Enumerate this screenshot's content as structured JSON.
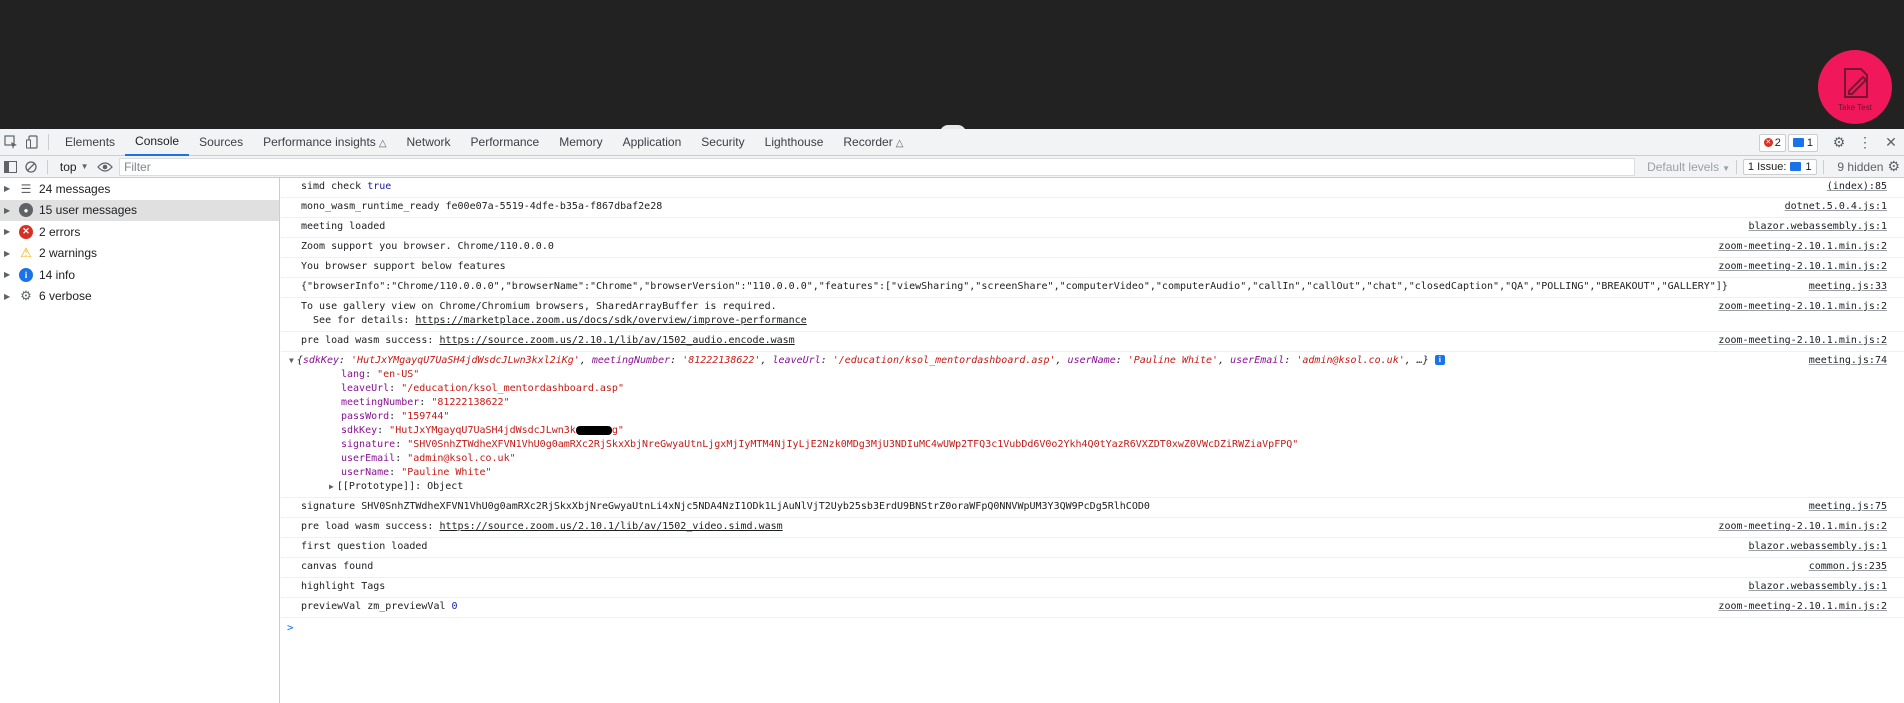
{
  "page": {
    "take_test_label": "Take Test"
  },
  "devtools": {
    "tabs": [
      {
        "label": "Elements"
      },
      {
        "label": "Console"
      },
      {
        "label": "Sources"
      },
      {
        "label": "Performance insights"
      },
      {
        "label": "Network"
      },
      {
        "label": "Performance"
      },
      {
        "label": "Memory"
      },
      {
        "label": "Application"
      },
      {
        "label": "Security"
      },
      {
        "label": "Lighthouse"
      },
      {
        "label": "Recorder"
      }
    ],
    "active_tab": "Console",
    "error_count": "2",
    "message_count": "1"
  },
  "toolbar": {
    "context": "top",
    "filter_placeholder": "Filter",
    "levels_label": "Default levels",
    "issues_label": "1 Issue:",
    "issues_count": "1",
    "hidden_label": "9 hidden"
  },
  "sidebar": {
    "items": [
      {
        "label": "24 messages",
        "icon": "list-icon"
      },
      {
        "label": "15 user messages",
        "icon": "user-icon"
      },
      {
        "label": "2 errors",
        "icon": "error-icon"
      },
      {
        "label": "2 warnings",
        "icon": "warning-icon"
      },
      {
        "label": "14 info",
        "icon": "info-icon"
      },
      {
        "label": "6 verbose",
        "icon": "verbose-icon"
      }
    ],
    "selected_index": 1
  },
  "console": {
    "messages": [
      {
        "text": "simd check ",
        "value": "true",
        "source": "(index):85"
      },
      {
        "text": "mono_wasm_runtime_ready fe00e07a-5519-4dfe-b35a-f867dbaf2e28",
        "source": "dotnet.5.0.4.js:1"
      },
      {
        "text": "meeting loaded",
        "source": "blazor.webassembly.js:1"
      },
      {
        "text": "Zoom support you browser. Chrome/110.0.0.0",
        "source": "zoom-meeting-2.10.1.min.js:2"
      },
      {
        "text": "You browser support below features",
        "source": "zoom-meeting-2.10.1.min.js:2"
      },
      {
        "text": "{\"browserInfo\":\"Chrome/110.0.0.0\",\"browserName\":\"Chrome\",\"browserVersion\":\"110.0.0.0\",\"features\":[\"viewSharing\",\"screenShare\",\"computerVideo\",\"computerAudio\",\"callIn\",\"callOut\",\"chat\",\"closedCaption\",\"QA\",\"POLLING\",\"BREAKOUT\",\"GALLERY\"]}",
        "source": "meeting.js:33"
      },
      {
        "text": "To use gallery view on Chrome/Chromium browsers, SharedArrayBuffer is required.",
        "text2": "  See for details: ",
        "link": "https://marketplace.zoom.us/docs/sdk/overview/improve-performance",
        "source": "zoom-meeting-2.10.1.min.js:2"
      },
      {
        "text": "pre load wasm success: ",
        "link": "https://source.zoom.us/2.10.1/lib/av/1502_audio.encode.wasm",
        "source": "zoom-meeting-2.10.1.min.js:2"
      }
    ],
    "object_entry": {
      "preview": {
        "sdkKey": "'HutJxYMgayqU7UaSH4jdWsdcJLwn3kxl2iKg'",
        "meetingNumber": "'81222138622'",
        "leaveUrl": "'/education/ksol_mentordashboard.asp'",
        "userName": "'Pauline White'",
        "userEmail": "'admin@ksol.co.uk'"
      },
      "source": "meeting.js:74",
      "props": [
        {
          "key": "lang",
          "value": "\"en-US\""
        },
        {
          "key": "leaveUrl",
          "value": "\"/education/ksol_mentordashboard.asp\""
        },
        {
          "key": "meetingNumber",
          "value": "\"81222138622\""
        },
        {
          "key": "passWord",
          "value": "\"159744\""
        },
        {
          "key": "sdkKey",
          "value": "\"HutJxYMgayqU7UaSH4jdWsdcJLwn3k",
          "value_tail": "g\""
        },
        {
          "key": "signature",
          "value": "\"SHV0SnhZTWdheXFVN1VhU0g0amRXc2RjSkxXbjNreGwyaUtnLjgxMjIyMTM4NjIyLjE2Nzk0MDg3MjU3NDIuMC4wUWp2TFQ3c1VubDd6V0o2Ykh4Q0tYazR6VXZDT0xwZ0VWcDZiRWZiaVpFPQ\""
        },
        {
          "key": "userEmail",
          "value": "\"admin@ksol.co.uk\""
        },
        {
          "key": "userName",
          "value": "\"Pauline White\""
        }
      ],
      "prototype": "[[Prototype]]: Object"
    },
    "messages_after": [
      {
        "text": "signature SHV0SnhZTWdheXFVN1VhU0g0amRXc2RjSkxXbjNreGwyaUtnLi4xNjc5NDA4NzI1ODk1LjAuNlVjT2Uyb25sb3ErdU9BNStrZ0oraWFpQ0NNVWpUM3Y3QW9PcDg5RlhCOD0",
        "source": "meeting.js:75"
      },
      {
        "text": "pre load wasm success: ",
        "link": "https://source.zoom.us/2.10.1/lib/av/1502_video.simd.wasm",
        "source": "zoom-meeting-2.10.1.min.js:2"
      },
      {
        "text": "first question loaded",
        "source": "blazor.webassembly.js:1"
      },
      {
        "text": "canvas found",
        "source": "common.js:235"
      },
      {
        "text": "highlight Tags",
        "source": "blazor.webassembly.js:1"
      },
      {
        "text": "previewVal zm_previewVal ",
        "value": "0",
        "source": "zoom-meeting-2.10.1.min.js:2"
      }
    ],
    "prompt": ">"
  },
  "colors": {
    "accent": "#1a73e8",
    "error": "#d93025",
    "warning": "#f9ab00",
    "take_test_bg": "#f0185a"
  }
}
